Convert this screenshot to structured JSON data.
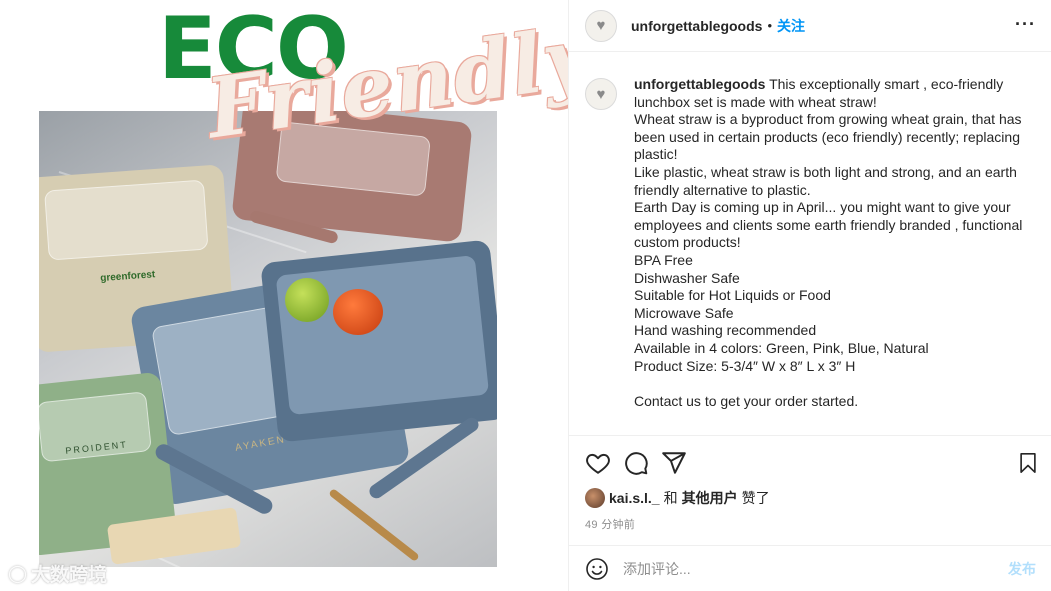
{
  "image": {
    "eco": "ECO",
    "friendly": "Friendly",
    "brands": [
      "greenforest",
      "AYAKEN",
      "PROIDENT"
    ],
    "watermark": "大数跨境",
    "colors": {
      "eco_green": "#178a3a",
      "friendly_fill": "#f7ece4",
      "friendly_outline": "#e9a99c"
    }
  },
  "header": {
    "username": "unforgettablegoods",
    "dot": "•",
    "follow_label": "关注",
    "more_icon": "more-horizontal-icon"
  },
  "caption": {
    "username": "unforgettablegoods",
    "lines": [
      "This exceptionally smart , eco-friendly lunchbox set is made with wheat straw!",
      "Wheat straw is a byproduct from growing wheat grain, that has been used in certain products (eco friendly) recently; replacing plastic!",
      "Like plastic, wheat straw is both light and strong, and an earth friendly alternative to plastic.",
      "Earth Day is coming up in April... you might want to give your employees and clients some earth friendly branded , functional custom products!",
      "BPA Free",
      "Dishwasher Safe",
      "Suitable for Hot Liquids or Food",
      "Microwave Safe",
      "Hand washing recommended",
      "Available in 4 colors: Green, Pink, Blue, Natural",
      "Product Size: 5-3/4″ W x 8″ L x 3″ H",
      "",
      "Contact us to get your order started."
    ]
  },
  "actions": {
    "icons": [
      "heart-icon",
      "comment-icon",
      "share-icon",
      "bookmark-icon"
    ],
    "likes": {
      "user": "kai.s.l._",
      "and": "和",
      "others": "其他用户",
      "liked": "赞了"
    },
    "time": "49 分钟前"
  },
  "comment": {
    "placeholder": "添加评论...",
    "post_label": "发布",
    "colors": {
      "post": "#b2dffc",
      "follow": "#0095f6"
    }
  }
}
